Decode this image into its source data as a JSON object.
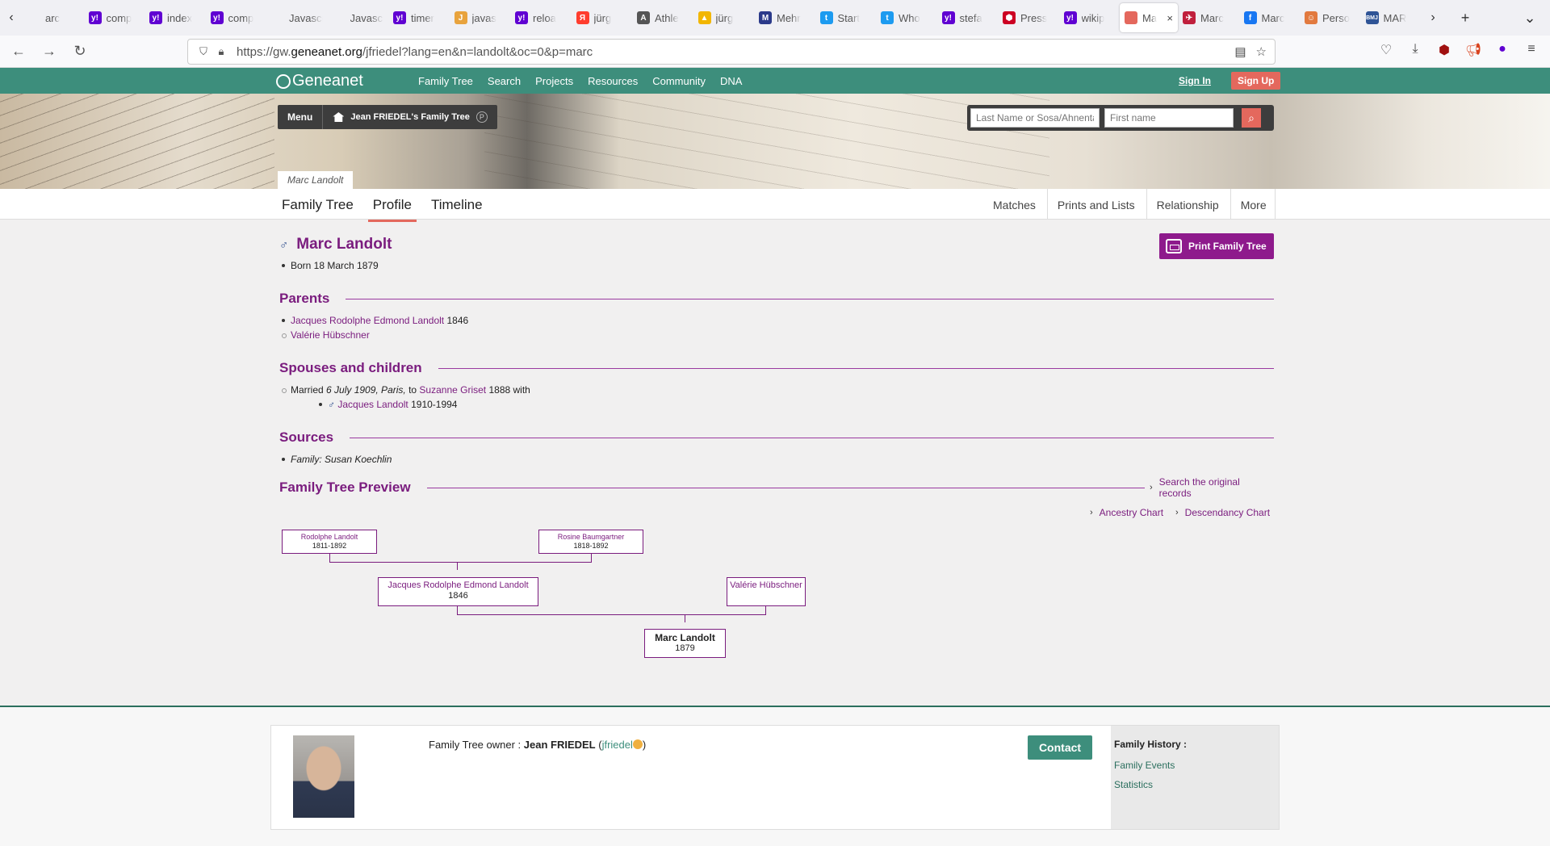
{
  "browser": {
    "tabs": [
      {
        "title": "arc",
        "color": "transparent",
        "glyph": ""
      },
      {
        "title": "comp",
        "color": "#6001d2",
        "glyph": "y!"
      },
      {
        "title": "index",
        "color": "#6001d2",
        "glyph": "y!"
      },
      {
        "title": "comp",
        "color": "#6001d2",
        "glyph": "y!"
      },
      {
        "title": "Javascri",
        "color": "transparent",
        "glyph": ""
      },
      {
        "title": "Javascri",
        "color": "transparent",
        "glyph": ""
      },
      {
        "title": "timer",
        "color": "#6001d2",
        "glyph": "y!"
      },
      {
        "title": "javas",
        "color": "#e8a33d",
        "glyph": "J"
      },
      {
        "title": "reloa",
        "color": "#6001d2",
        "glyph": "y!"
      },
      {
        "title": "jürg",
        "color": "#ff3d2e",
        "glyph": "Я"
      },
      {
        "title": "Athle",
        "color": "#555",
        "glyph": "A"
      },
      {
        "title": "jürg",
        "color": "#f2b600",
        "glyph": "▲"
      },
      {
        "title": "Mehr",
        "color": "#2b3a8a",
        "glyph": "M"
      },
      {
        "title": "Start",
        "color": "#1d9bf0",
        "glyph": "t"
      },
      {
        "title": "Who",
        "color": "#1d9bf0",
        "glyph": "t"
      },
      {
        "title": "stefa",
        "color": "#6001d2",
        "glyph": "y!"
      },
      {
        "title": "Press",
        "color": "#cc0022",
        "glyph": "⬢"
      },
      {
        "title": "wikip",
        "color": "#6001d2",
        "glyph": "y!"
      }
    ],
    "active_tab": {
      "title": "Ma",
      "color": "#e4685d"
    },
    "tabs_after": [
      {
        "title": "Marc",
        "color": "#c01f3c",
        "glyph": "✈"
      },
      {
        "title": "Marc",
        "color": "#1877f2",
        "glyph": "f"
      },
      {
        "title": "Perso",
        "color": "#e27a3f",
        "glyph": "☺"
      },
      {
        "title": "MAR",
        "color": "#2f5496",
        "glyph": "BMJ"
      }
    ],
    "url_prefix": "https://gw.",
    "url_domain": "geneanet.org",
    "url_rest": "/jfriedel?lang=en&n=landolt&oc=0&p=marc"
  },
  "site": {
    "logo": "Geneanet",
    "menu": [
      "Family Tree",
      "Search",
      "Projects",
      "Resources",
      "Community",
      "DNA"
    ],
    "sign_in": "Sign In",
    "sign_up": "Sign Up",
    "breadcrumb_menu": "Menu",
    "breadcrumb_tree": "Jean FRIEDEL's Family Tree",
    "badge": "P",
    "search_last_placeholder": "Last Name or Sosa/Ahnentafel",
    "search_first_placeholder": "First name",
    "name_tab": "Marc Landolt"
  },
  "subnav": {
    "left": [
      "Family Tree",
      "Profile",
      "Timeline"
    ],
    "right": [
      "Matches",
      "Prints and Lists",
      "Relationship",
      "More"
    ]
  },
  "person": {
    "gender_symbol": "♂",
    "name": "Marc Landolt",
    "born": "Born 18 March 1879",
    "print_button": "Print Family Tree"
  },
  "parents": {
    "heading": "Parents",
    "father_name": "Jacques Rodolphe Edmond Landolt",
    "father_year": "1846",
    "mother_name": "Valérie Hübschner"
  },
  "spouses": {
    "heading": "Spouses and children",
    "married_prefix": "Married ",
    "married_date_place": "6 July 1909, Paris,",
    "married_to": " to ",
    "spouse_name": "Suzanne Griset",
    "spouse_suffix": " 1888 with",
    "child_symbol": "♂",
    "child_name": "Jacques Landolt",
    "child_years": "1910-1994"
  },
  "sources": {
    "heading": "Sources",
    "item": "Family: Susan Koechlin"
  },
  "preview": {
    "heading": "Family Tree Preview",
    "search_records": "Search the original records",
    "ancestry": "Ancestry Chart",
    "descendancy": "Descendancy Chart",
    "gp1_name": "Rodolphe Landolt",
    "gp1_years": "1811-1892",
    "gp2_name": "Rosine Baumgartner",
    "gp2_years": "1818-1892",
    "father_name": "Jacques Rodolphe Edmond Landolt",
    "father_year": "1846",
    "mother_name": "Valérie Hübschner",
    "self_name": "Marc Landolt",
    "self_year": "1879"
  },
  "footer": {
    "owner_label": "Family Tree owner : ",
    "owner_name": "Jean FRIEDEL",
    "owner_id": "jfriedel",
    "contact": "Contact",
    "history_title": "Family History :",
    "history_links": [
      "Family Events",
      "Statistics"
    ]
  }
}
